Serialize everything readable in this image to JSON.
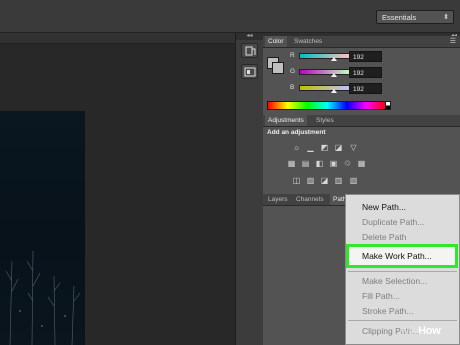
{
  "workspace": {
    "label": "Essentials",
    "arrow": "⬍"
  },
  "dock": {
    "collapse": "◂◂",
    "tools": [
      "history-tool-icon",
      "properties-tool-icon"
    ]
  },
  "panels": {
    "collapse": "◂◂",
    "color_tabs": [
      "Color",
      "Swatches"
    ],
    "channels": [
      {
        "label": "R",
        "value": "192",
        "color": "#ff0000"
      },
      {
        "label": "G",
        "value": "192",
        "color": "#00ff00"
      },
      {
        "label": "B",
        "value": "192",
        "color": "#0000ff"
      }
    ],
    "adjust_tabs": [
      "Adjustments",
      "Styles"
    ],
    "adjust_heading": "Add an adjustment",
    "layer_tabs": [
      "Layers",
      "Channels",
      "Path"
    ],
    "menu_icon": "☰"
  },
  "context_menu": {
    "items": [
      {
        "label": "New Path...",
        "enabled": true
      },
      {
        "label": "Duplicate Path...",
        "enabled": false
      },
      {
        "label": "Delete Path",
        "enabled": false
      },
      {
        "label": "Make Work Path...",
        "enabled": true,
        "highlighted": true
      },
      {
        "label": "Make Selection...",
        "enabled": false
      },
      {
        "label": "Fill Path...",
        "enabled": false
      },
      {
        "label": "Stroke Path...",
        "enabled": false
      },
      {
        "label": "Clipping Path...",
        "enabled": false
      }
    ]
  },
  "watermark": {
    "part1": "wiki",
    "part2": "How"
  },
  "colors": {
    "highlight": "#2fe72b",
    "panel": "#535353"
  }
}
